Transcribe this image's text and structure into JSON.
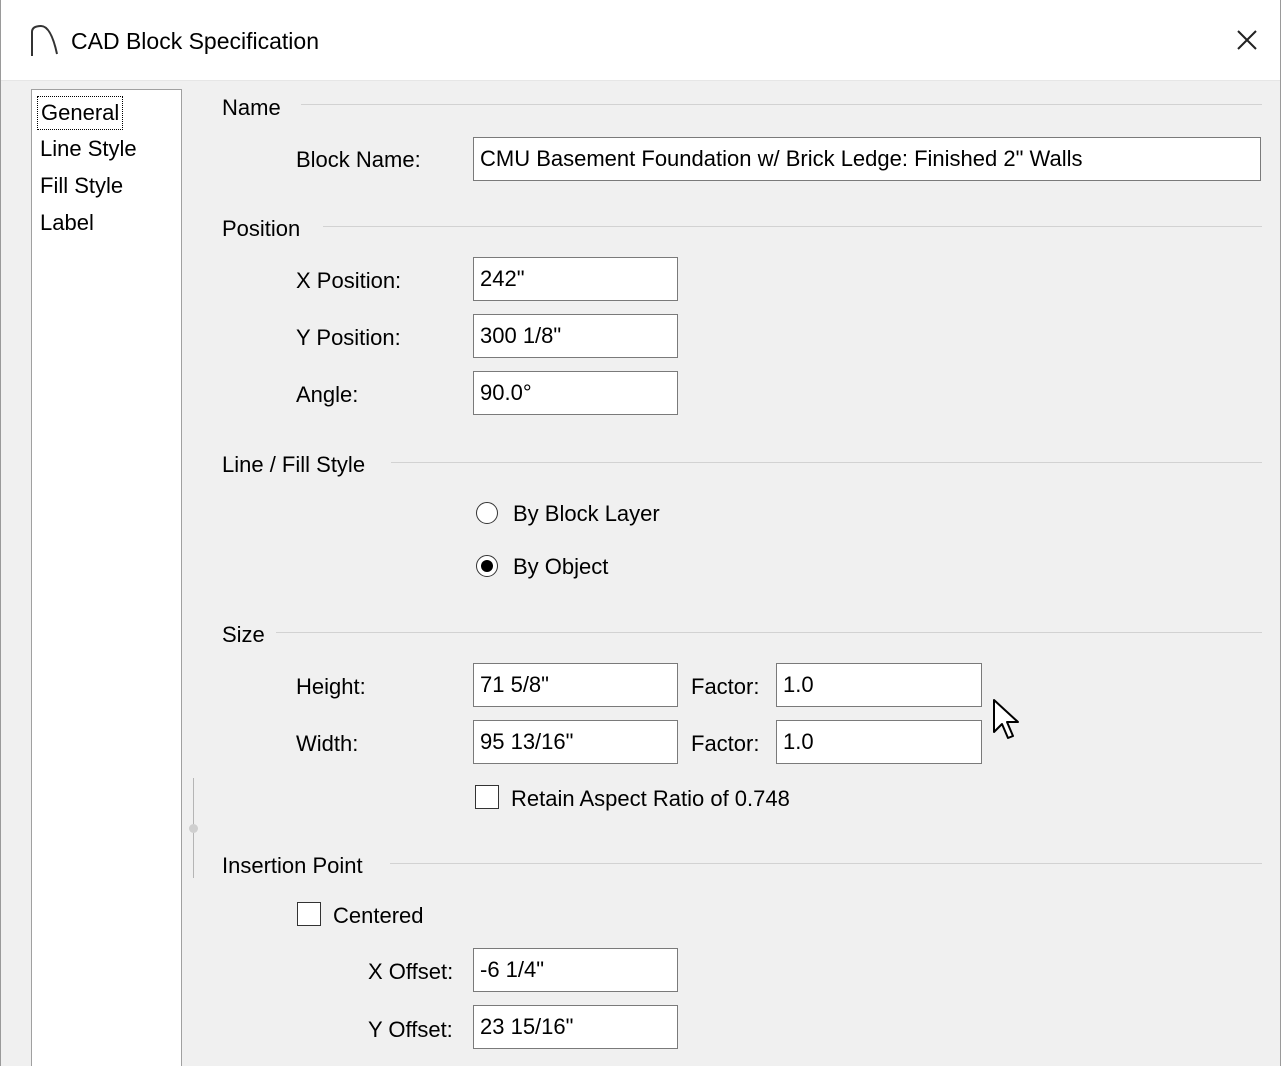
{
  "window": {
    "title": "CAD Block Specification"
  },
  "nav": {
    "items": [
      "General",
      "Line Style",
      "Fill Style",
      "Label"
    ],
    "selected": "General"
  },
  "name_section": {
    "title": "Name",
    "block_name_label": "Block Name:",
    "block_name_value": "CMU Basement Foundation w/ Brick Ledge: Finished 2\" Walls"
  },
  "position_section": {
    "title": "Position",
    "x_label": "X Position:",
    "x_value": "242\"",
    "y_label": "Y Position:",
    "y_value": "300 1/8\"",
    "angle_label": "Angle:",
    "angle_value": "90.0°"
  },
  "line_fill_section": {
    "title": "Line / Fill Style",
    "options": [
      "By Block Layer",
      "By Object"
    ],
    "selected": "By Object"
  },
  "size_section": {
    "title": "Size",
    "height_label": "Height:",
    "height_value": "71 5/8\"",
    "height_factor_label": "Factor:",
    "height_factor_value": "1.0",
    "width_label": "Width:",
    "width_value": "95 13/16\"",
    "width_factor_label": "Factor:",
    "width_factor_value": "1.0",
    "retain_aspect_label": "Retain Aspect Ratio of 0.748",
    "retain_aspect_checked": false
  },
  "insertion_section": {
    "title": "Insertion Point",
    "centered_label": "Centered",
    "centered_checked": false,
    "x_offset_label": "X Offset:",
    "x_offset_value": "-6 1/4\"",
    "y_offset_label": "Y Offset:",
    "y_offset_value": "23 15/16\""
  }
}
